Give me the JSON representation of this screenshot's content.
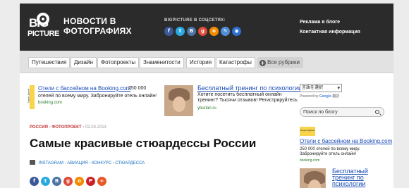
{
  "logo": {
    "big": "BIG",
    "picture": "PICTURE"
  },
  "header": {
    "title": "НОВОСТИ В ФОТОГРАФИЯХ",
    "social_label": "BIGPICTURE В СОЦСЕТЯХ:",
    "social_icons": [
      {
        "icon": "facebook-icon",
        "glyph": "f",
        "color": "#3b5998"
      },
      {
        "icon": "twitter-icon",
        "glyph": "t",
        "color": "#2aa9e0"
      },
      {
        "icon": "vk-icon",
        "glyph": "B",
        "color": "#4c75a3"
      },
      {
        "icon": "google-plus-icon",
        "glyph": "g",
        "color": "#dd4b39"
      },
      {
        "icon": "odnoklassniki-icon",
        "glyph": "o",
        "color": "#f28b00"
      },
      {
        "icon": "livejournal-icon",
        "glyph": "✎",
        "color": "#4f8fd6"
      },
      {
        "icon": "rss-icon",
        "glyph": "◉",
        "color": "#2f6fd0"
      }
    ],
    "links": [
      "Реклама в блоге",
      "Контактная информация"
    ]
  },
  "nav": {
    "items": [
      "Путешествия",
      "Дизайн",
      "Фотопроекты",
      "Знаменитости",
      "История",
      "Катастрофы"
    ],
    "more": "Все рубрики"
  },
  "ads": {
    "ad_tag": "Яндекс.Директ",
    "booking": {
      "title": "Отели с бассейном на Booking.com",
      "price": "250 000",
      "desc": "отелей по всему миру. Забронируйте отель онлайн!",
      "url": "booking.com"
    },
    "psych": {
      "title": "Бесплатный тренинг по психологии",
      "desc": "Хотите посетить бесплатный онлайн тренинг? Тысячи отзывов! Регистрируйтесь",
      "url": "yburlan.ru"
    }
  },
  "article": {
    "breadcrumb": [
      "РОССИЯ",
      "ФОТОПРОЕКТ",
      "02.03.2014"
    ],
    "title": "Самые красивые стюардессы России",
    "tags": [
      "INSTAGRAM",
      "АВИАЦИЯ",
      "КОНКУРС",
      "СТЮАРДЕССА"
    ],
    "share_icons": [
      {
        "icon": "facebook-icon",
        "glyph": "f",
        "color": "#3b5998"
      },
      {
        "icon": "twitter-icon",
        "glyph": "t",
        "color": "#2aa9e0"
      },
      {
        "icon": "vk-icon",
        "glyph": "B",
        "color": "#4c75a3"
      },
      {
        "icon": "google-plus-icon",
        "glyph": "g",
        "color": "#dd4b39"
      },
      {
        "icon": "odnoklassniki-icon",
        "glyph": "o",
        "color": "#f28b00"
      },
      {
        "icon": "pinterest-icon",
        "glyph": "P",
        "color": "#cb2027"
      },
      {
        "icon": "more-share-icon",
        "glyph": "+",
        "color": "#e8592a"
      }
    ]
  },
  "sidebar": {
    "translate": {
      "select": "言語を選択",
      "powered_prefix": "Powered by",
      "google": "Google",
      "translate_word": "翻訳"
    },
    "search_placeholder": "Поиск по блогу",
    "ad": {
      "tag": "Яндекс.Директ",
      "title": "Отели с бассейном на Booking.com",
      "desc": "250 000 отелей по всему миру. Забронируйте отель онлайн!",
      "url": "booking.com"
    },
    "ad2": {
      "title": "Бесплатный тренинг по психологии"
    }
  }
}
